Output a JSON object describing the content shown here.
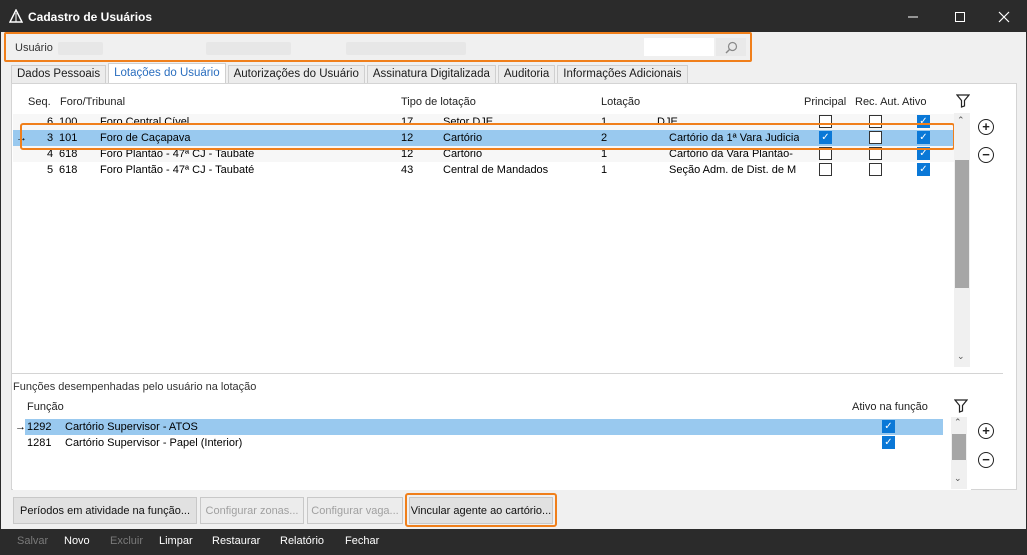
{
  "window": {
    "title": "Cadastro de Usuários"
  },
  "search": {
    "label": "Usuário",
    "icon": "search-icon"
  },
  "tabs": [
    {
      "label": "Dados Pessoais",
      "active": false
    },
    {
      "label": "Lotações do Usuário",
      "active": true
    },
    {
      "label": "Autorizações do Usuário",
      "active": false
    },
    {
      "label": "Assinatura Digitalizada",
      "active": false
    },
    {
      "label": "Auditoria",
      "active": false
    },
    {
      "label": "Informações Adicionais",
      "active": false
    }
  ],
  "lotacoes": {
    "columns": {
      "seq": "Seq.",
      "foro": "Foro/Tribunal",
      "tipo": "Tipo de lotação",
      "lotacao": "Lotação",
      "principal": "Principal",
      "rec_aut": "Rec. Aut.",
      "ativo": "Ativo"
    },
    "rows": [
      {
        "seq": "6",
        "foro_code": "100",
        "foro": "Foro Central Cível",
        "tipo_code": "17",
        "tipo": "Setor DJE",
        "lotacao_code": "1",
        "lotacao": "DJE",
        "principal": false,
        "rec_aut": false,
        "ativo": true
      },
      {
        "seq": "3",
        "foro_code": "101",
        "foro": "Foro de Caçapava",
        "tipo_code": "12",
        "tipo": "Cartório",
        "lotacao_code": "2",
        "lotacao": "Cartório da 1ª Vara Judicia",
        "principal": true,
        "rec_aut": false,
        "ativo": true
      },
      {
        "seq": "4",
        "foro_code": "618",
        "foro": "Foro Plantão - 47ª CJ - Taubate",
        "tipo_code": "12",
        "tipo": "Cartório",
        "lotacao_code": "1",
        "lotacao": "Cartório da Vara Plantão-",
        "principal": false,
        "rec_aut": false,
        "ativo": true
      },
      {
        "seq": "5",
        "foro_code": "618",
        "foro": "Foro Plantão - 47ª CJ - Taubaté",
        "tipo_code": "43",
        "tipo": "Central de Mandados",
        "lotacao_code": "1",
        "lotacao": "Seção Adm. de Dist. de M",
        "principal": false,
        "rec_aut": false,
        "ativo": true
      }
    ],
    "selected_index": 1
  },
  "funcoes": {
    "title": "Funções desempenhadas pelo usuário na lotação",
    "columns": {
      "funcao": "Função",
      "ativo": "Ativo na função"
    },
    "rows": [
      {
        "code": "1292",
        "name": "Cartório Supervisor - ATOS",
        "ativo": true
      },
      {
        "code": "1281",
        "name": "Cartório Supervisor - Papel (Interior)",
        "ativo": true
      }
    ],
    "selected_index": 0
  },
  "buttons": {
    "periodos": "Períodos em atividade na função...",
    "zonas": "Configurar zonas...",
    "vaga": "Configurar vaga...",
    "vincular": "Vincular agente ao cartório..."
  },
  "commands": {
    "salvar": "Salvar",
    "novo": "Novo",
    "excluir": "Excluir",
    "limpar": "Limpar",
    "restaurar": "Restaurar",
    "relatorio": "Relatório",
    "fechar": "Fechar"
  },
  "colors": {
    "highlight": "#f07f1b",
    "selection": "#99c9ef",
    "check": "#0a78d7",
    "dark_bar": "#2b2b2b",
    "active_tab_text": "#2a6ebf"
  }
}
